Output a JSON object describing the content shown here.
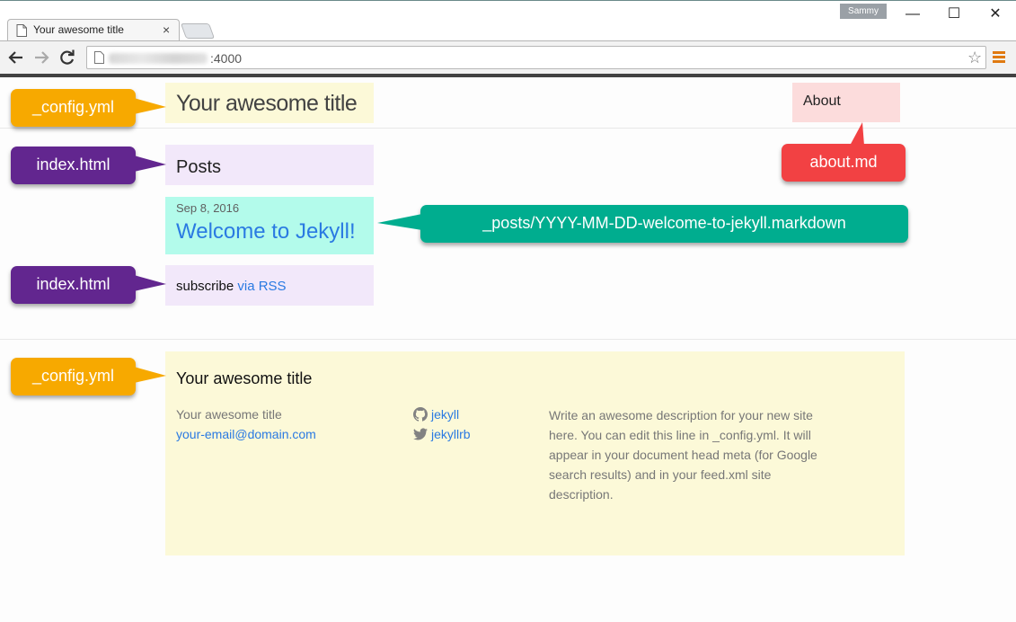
{
  "browser": {
    "tab_title": "Your awesome title",
    "url_port": ":4000",
    "profile_name": "Sammy",
    "window_controls": {
      "minimize": "—",
      "maximize": "☐",
      "close": "✕"
    },
    "tab_close": "×",
    "icons": {
      "back": "back-arrow-icon",
      "forward": "forward-arrow-icon",
      "reload": "reload-icon",
      "star": "bookmark-star-icon",
      "menu": "hamburger-menu-icon"
    }
  },
  "header": {
    "site_title": "Your awesome title",
    "about_label": "About"
  },
  "main": {
    "posts_heading": "Posts",
    "post": {
      "date": "Sep 8, 2016",
      "title": "Welcome to Jekyll!"
    },
    "subscribe_text": "subscribe",
    "rss_link": "via RSS"
  },
  "footer": {
    "heading": "Your awesome title",
    "name": "Your awesome title",
    "email": "your-email@domain.com",
    "github_user": "jekyll",
    "twitter_user": "jekyllrb",
    "description": "Write an awesome description for your new site here. You can edit this line in _config.yml. It will appear in your document head meta (for Google search results) and in your feed.xml site description."
  },
  "callouts": {
    "config_top": "_config.yml",
    "index_posts": "index.html",
    "index_rss": "index.html",
    "config_footer": "_config.yml",
    "about_md": "about.md",
    "post_file": "_posts/YYYY-MM-DD-welcome-to-jekyll.markdown"
  },
  "colors": {
    "callout_orange": "#f7a900",
    "callout_purple": "#62268f",
    "callout_red": "#f24143",
    "callout_teal": "#00ad8f",
    "highlight_yellow": "#fcf9d8",
    "highlight_purple": "#f2e8fa",
    "highlight_pink": "#fcdcdc",
    "highlight_teal": "#b3fbeb",
    "link_blue": "#2a7ae2"
  }
}
